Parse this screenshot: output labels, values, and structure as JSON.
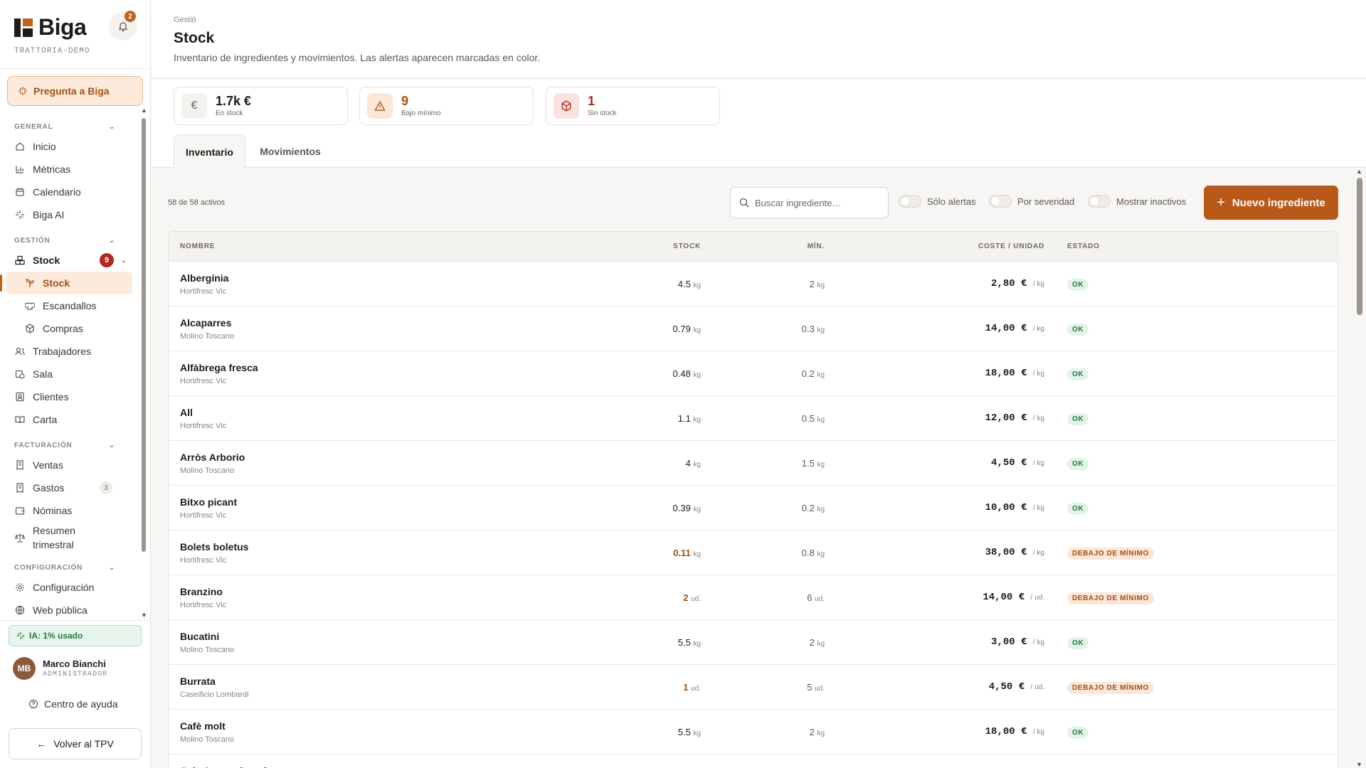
{
  "brand": {
    "name": "Biga",
    "tenant": "TRATTORIA-DEMO",
    "notifications": "2"
  },
  "ask_button": "Pregunta a Biga",
  "nav": {
    "general": "GENERAL",
    "inicio": "Inicio",
    "metricas": "Métricas",
    "calendario": "Calendario",
    "biga_ai": "Biga AI",
    "gestion": "GESTIÓN",
    "stock": "Stock",
    "stock_count": "9",
    "stock_sub": "Stock",
    "escandallos": "Escandallos",
    "compras": "Compras",
    "trabajadores": "Trabajadores",
    "sala": "Sala",
    "clientes": "Clientes",
    "carta": "Carta",
    "facturacion": "FACTURACIÓN",
    "ventas": "Ventas",
    "gastos": "Gastos",
    "gastos_count": "3",
    "nominas": "Nóminas",
    "resumen_1": "Resumen",
    "resumen_2": "trimestral",
    "configuracion_sec": "CONFIGURACIÓN",
    "configuracion": "Configuración",
    "web_publica": "Web pública"
  },
  "ai_usage": "IA: 1% usado",
  "user": {
    "initials": "MB",
    "name": "Marco Bianchi",
    "role": "ADMINISTRADOR"
  },
  "help": "Centro de ayuda",
  "back_button": "Volver al TPV",
  "header": {
    "breadcrumb": "Gestió",
    "title": "Stock",
    "subtitle": "Inventario de ingredientes y movimientos. Las alertas aparecen marcadas en color."
  },
  "kpis": [
    {
      "value": "1.7k €",
      "label": "En stock"
    },
    {
      "value": "9",
      "label": "Bajo mínimo"
    },
    {
      "value": "1",
      "label": "Sin stock"
    }
  ],
  "tabs": {
    "inventario": "Inventario",
    "movimientos": "Movimientos"
  },
  "toolbar": {
    "count": "58 de 58 activos",
    "search_placeholder": "Buscar ingrediente…",
    "solo_alertas": "Sólo alertas",
    "por_severidad": "Por severidad",
    "mostrar_inactivos": "Mostrar inactivos",
    "new_button": "Nuevo ingrediente"
  },
  "table": {
    "headers": {
      "nombre": "NOMBRE",
      "stock": "STOCK",
      "min": "MÍN.",
      "coste": "COSTE / UNIDAD",
      "estado": "ESTADO"
    },
    "rows": [
      {
        "name": "Albergínia",
        "supplier": "Hortifresc Vic",
        "stock": "4.5",
        "stock_unit": "kg",
        "min": "2",
        "min_unit": "kg",
        "cost": "2,80 €",
        "cost_unit": "/ kg",
        "status": "OK"
      },
      {
        "name": "Alcaparres",
        "supplier": "Molino Toscano",
        "stock": "0.79",
        "stock_unit": "kg",
        "min": "0.3",
        "min_unit": "kg",
        "cost": "14,00 €",
        "cost_unit": "/ kg",
        "status": "OK"
      },
      {
        "name": "Alfàbrega fresca",
        "supplier": "Hortifresc Vic",
        "stock": "0.48",
        "stock_unit": "kg",
        "min": "0.2",
        "min_unit": "kg",
        "cost": "18,00 €",
        "cost_unit": "/ kg",
        "status": "OK"
      },
      {
        "name": "All",
        "supplier": "Hortifresc Vic",
        "stock": "1.1",
        "stock_unit": "kg",
        "min": "0.5",
        "min_unit": "kg",
        "cost": "12,00 €",
        "cost_unit": "/ kg",
        "status": "OK"
      },
      {
        "name": "Arròs Arborio",
        "supplier": "Molino Toscano",
        "stock": "4",
        "stock_unit": "kg",
        "min": "1.5",
        "min_unit": "kg",
        "cost": "4,50 €",
        "cost_unit": "/ kg",
        "status": "OK"
      },
      {
        "name": "Bitxo picant",
        "supplier": "Hortifresc Vic",
        "stock": "0.39",
        "stock_unit": "kg",
        "min": "0.2",
        "min_unit": "kg",
        "cost": "10,00 €",
        "cost_unit": "/ kg",
        "status": "OK"
      },
      {
        "name": "Bolets boletus",
        "supplier": "Hortifresc Vic",
        "stock": "0.11",
        "stock_unit": "kg",
        "min": "0.8",
        "min_unit": "kg",
        "cost": "38,00 €",
        "cost_unit": "/ kg",
        "status": "DEBAJO DE MÍNIMO"
      },
      {
        "name": "Branzino",
        "supplier": "Hortifresc Vic",
        "stock": "2",
        "stock_unit": "ud.",
        "min": "6",
        "min_unit": "ud.",
        "cost": "14,00 €",
        "cost_unit": "/ ud.",
        "status": "DEBAJO DE MÍNIMO"
      },
      {
        "name": "Bucatini",
        "supplier": "Molino Toscano",
        "stock": "5.5",
        "stock_unit": "kg",
        "min": "2",
        "min_unit": "kg",
        "cost": "3,00 €",
        "cost_unit": "/ kg",
        "status": "OK"
      },
      {
        "name": "Burrata",
        "supplier": "Caseificio Lombardi",
        "stock": "1",
        "stock_unit": "ud.",
        "min": "5",
        "min_unit": "ud.",
        "cost": "4,50 €",
        "cost_unit": "/ ud.",
        "status": "DEBAJO DE MÍNIMO"
      },
      {
        "name": "Cafè molt",
        "supplier": "Molino Toscano",
        "stock": "5.5",
        "stock_unit": "kg",
        "min": "2",
        "min_unit": "kg",
        "cost": "18,00 €",
        "cost_unit": "/ kg",
        "status": "OK"
      },
      {
        "name": "Caja Agua mineral",
        "supplier": "",
        "stock": "",
        "stock_unit": "",
        "min": "",
        "min_unit": "",
        "cost": "",
        "cost_unit": "",
        "status": ""
      }
    ]
  }
}
